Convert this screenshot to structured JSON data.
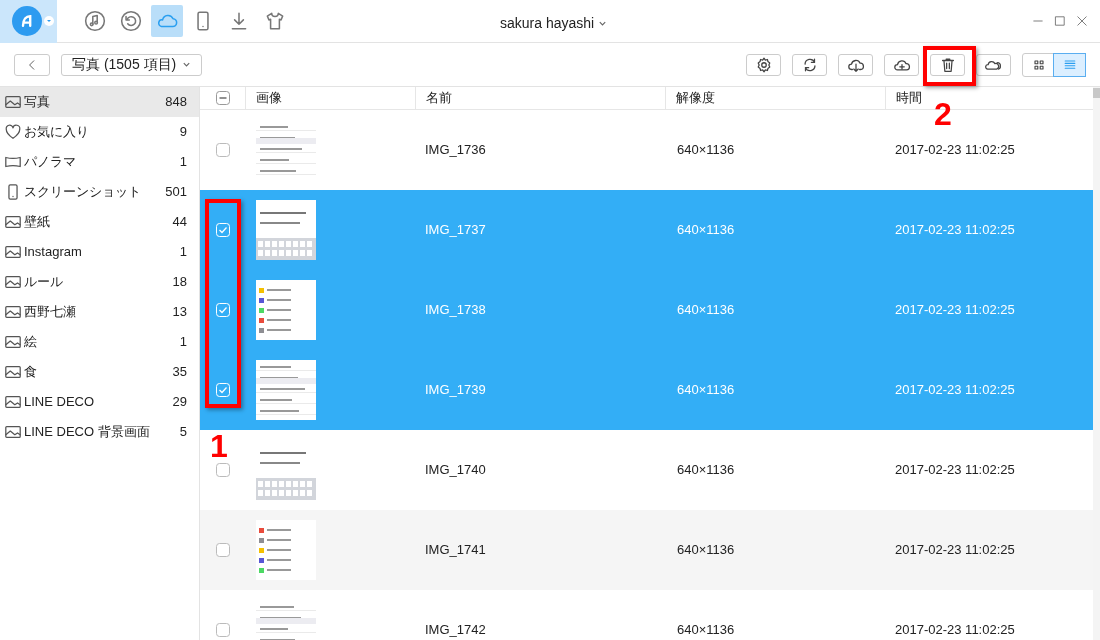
{
  "window": {
    "title": "sakura hayashi"
  },
  "nav": [
    {
      "kind": "music",
      "selected": false
    },
    {
      "kind": "restore",
      "selected": false
    },
    {
      "kind": "cloud",
      "selected": true
    },
    {
      "kind": "phone",
      "selected": false
    },
    {
      "kind": "download",
      "selected": false
    },
    {
      "kind": "shirt",
      "selected": false
    }
  ],
  "toolbar": {
    "album_dropdown": "写真 (1505 項目)",
    "buttons": [
      {
        "kind": "settings"
      },
      {
        "kind": "sync"
      },
      {
        "kind": "cloud-download"
      },
      {
        "kind": "cloud-upload"
      },
      {
        "kind": "trash"
      },
      {
        "kind": "clouds"
      }
    ],
    "views": [
      {
        "kind": "grid",
        "selected": false
      },
      {
        "kind": "list",
        "selected": true
      }
    ]
  },
  "sidebar": {
    "items": [
      {
        "label": "写真",
        "count": "848",
        "selected": true
      },
      {
        "kind": "heart",
        "label": "お気に入り",
        "count": "9",
        "selected": false
      },
      {
        "kind": "panorama",
        "label": "パノラマ",
        "count": "1",
        "selected": false
      },
      {
        "kind": "phone",
        "label": "スクリーンショット",
        "count": "501",
        "selected": false
      },
      {
        "label": "壁紙",
        "count": "44",
        "selected": false
      },
      {
        "label": "Instagram",
        "count": "1",
        "selected": false
      },
      {
        "label": "ルール",
        "count": "18",
        "selected": false
      },
      {
        "label": "西野七瀬",
        "count": "13",
        "selected": false
      },
      {
        "label": "絵",
        "count": "1",
        "selected": false
      },
      {
        "label": "食",
        "count": "35",
        "selected": false
      },
      {
        "label": "LINE DECO",
        "count": "29",
        "selected": false
      },
      {
        "label": "LINE DECO 背景画面",
        "count": "5",
        "selected": false
      }
    ]
  },
  "table": {
    "columns": [
      "画像",
      "名前",
      "解像度",
      "時間"
    ],
    "select_all": {
      "indeterminate": true
    },
    "rows": [
      {
        "name": "IMG_1736",
        "resolution": "640×1136",
        "time": "2017-02-23 11:02:25",
        "selected": false
      },
      {
        "name": "IMG_1737",
        "resolution": "640×1136",
        "time": "2017-02-23 11:02:25",
        "selected": true
      },
      {
        "name": "IMG_1738",
        "resolution": "640×1136",
        "time": "2017-02-23 11:02:25",
        "selected": true
      },
      {
        "name": "IMG_1739",
        "resolution": "640×1136",
        "time": "2017-02-23 11:02:25",
        "selected": true
      },
      {
        "name": "IMG_1740",
        "resolution": "640×1136",
        "time": "2017-02-23 11:02:25",
        "selected": false
      },
      {
        "name": "IMG_1741",
        "resolution": "640×1136",
        "time": "2017-02-23 11:02:25",
        "selected": false
      },
      {
        "name": "IMG_1742",
        "resolution": "640×1136",
        "time": "2017-02-23 11:02:25",
        "selected": false
      }
    ]
  },
  "annotations": [
    {
      "label": "1"
    },
    {
      "label": "2"
    }
  ]
}
